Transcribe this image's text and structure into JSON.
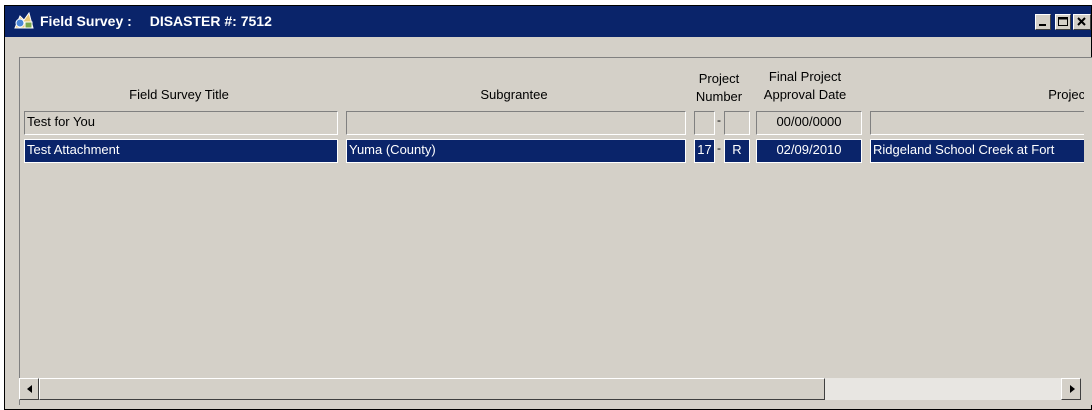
{
  "window": {
    "title": "Field Survey :",
    "disaster_label": "DISASTER #: 7512"
  },
  "grid": {
    "headers": {
      "field_survey_title": "Field Survey Title",
      "subgrantee": "Subgrantee",
      "project_number_1": "Project",
      "project_number_2": "Number",
      "final_date_1": "Final Project",
      "final_date_2": "Approval Date",
      "project_title": "Project T"
    },
    "rows": [
      {
        "title": "Test for You",
        "subgrantee": "",
        "proj_num_a": "",
        "proj_sep": "-",
        "proj_num_b": "",
        "approval_date": "00/00/0000",
        "project_title": ""
      },
      {
        "title": "Test Attachment",
        "subgrantee": "Yuma (County)",
        "proj_num_a": "17",
        "proj_sep": "-",
        "proj_num_b": "R",
        "approval_date": "02/09/2010",
        "project_title": "Ridgeland School Creek at Fort"
      }
    ],
    "selected_row": 1
  },
  "icons": {
    "app": "field-survey-app-icon",
    "minimize": "minimize-icon",
    "maximize": "maximize-icon",
    "close": "close-icon",
    "scroll_left": "scroll-left-arrow-icon",
    "scroll_right": "scroll-right-arrow-icon"
  },
  "colors": {
    "titlebar": "#0a246a",
    "selection": "#0a246a",
    "face": "#d4d0c8"
  }
}
